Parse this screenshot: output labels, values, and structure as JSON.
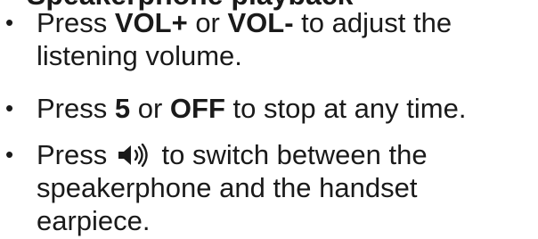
{
  "heading_partial": "Speakerphone playback",
  "bullets": [
    {
      "pre": "Press ",
      "key1": "VOL+",
      "mid": " or ",
      "key2": "VOL-",
      "post": " to adjust the listening volume."
    },
    {
      "pre": "Press ",
      "key1": "5",
      "mid": " or ",
      "key2": "OFF",
      "post": " to stop at any time."
    },
    {
      "pre": "Press ",
      "icon": "speaker-icon",
      "post": " to switch between the speakerphone and the handset earpiece."
    }
  ]
}
